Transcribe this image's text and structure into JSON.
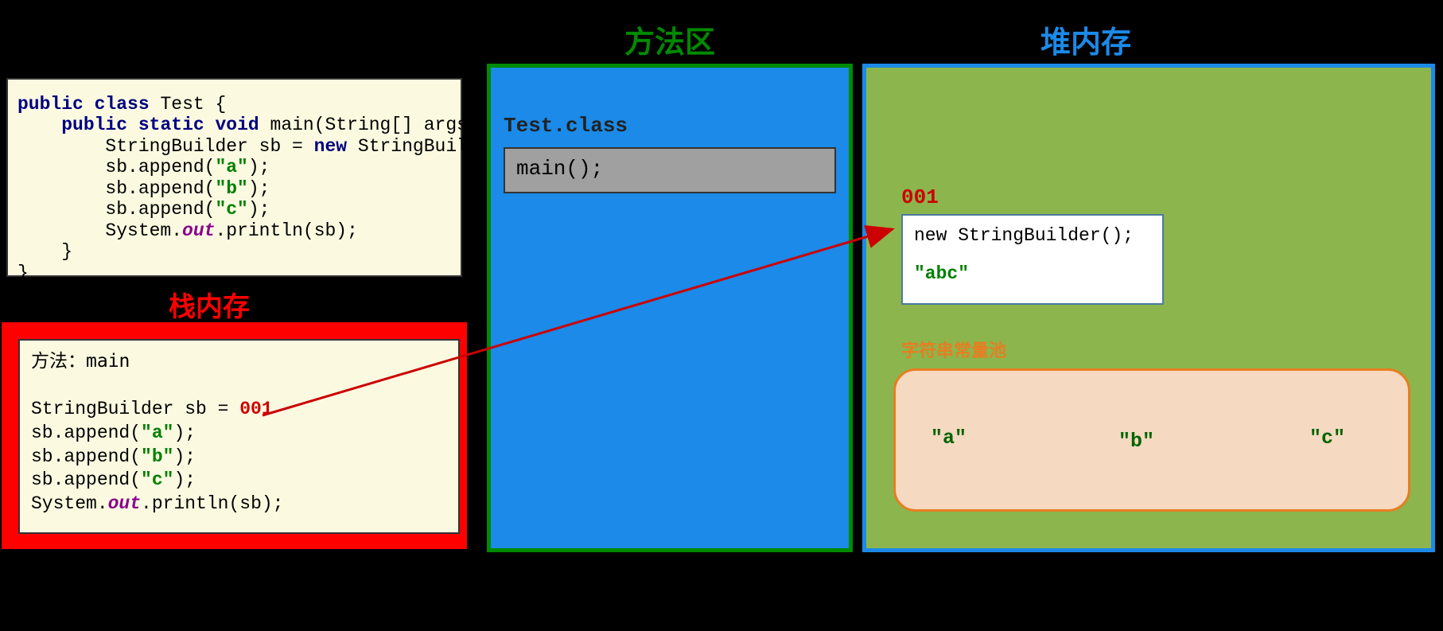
{
  "labels": {
    "method_area": "方法区",
    "heap": "堆内存",
    "stack": "栈内存",
    "string_pool": "字符串常量池"
  },
  "code": {
    "l1_kw1": "public",
    "l1_kw2": "class",
    "l1_rest": " Test {",
    "l2_kw1": "public",
    "l2_kw2": "static",
    "l2_kw3": "void",
    "l2_rest": " main(String[] args) {",
    "l3_a": "        StringBuilder sb = ",
    "l3_kw": "new",
    "l3_b": " StringBuilder();",
    "l4_a": "        sb.append(",
    "l4_s": "\"a\"",
    "l4_b": ");",
    "l5_a": "        sb.append(",
    "l5_s": "\"b\"",
    "l5_b": ");",
    "l6_a": "        sb.append(",
    "l6_s": "\"c\"",
    "l6_b": ");",
    "l7_a": "        System.",
    "l7_out": "out",
    "l7_b": ".println(sb);",
    "l8": "    }",
    "l9": "}"
  },
  "stack": {
    "l1_a": "方法：",
    "l1_b": "main",
    "l3_a": "StringBuilder sb = ",
    "l3_addr": "001",
    "l4_a": "sb.append(",
    "l4_s": "\"a\"",
    "l4_b": ");",
    "l5_a": "sb.append(",
    "l5_s": "\"b\"",
    "l5_b": ");",
    "l6_a": "sb.append(",
    "l6_s": "\"c\"",
    "l6_b": ");",
    "l7_a": "System.",
    "l7_out": "out",
    "l7_b": ".println(sb);"
  },
  "method": {
    "class_label": "Test.class",
    "main_label": "main();"
  },
  "heap": {
    "addr": "001",
    "obj_line1": "new StringBuilder();",
    "obj_value": "\"abc\"",
    "pool": {
      "a": "\"a\"",
      "b": "\"b\"",
      "c": "\"c\""
    }
  }
}
